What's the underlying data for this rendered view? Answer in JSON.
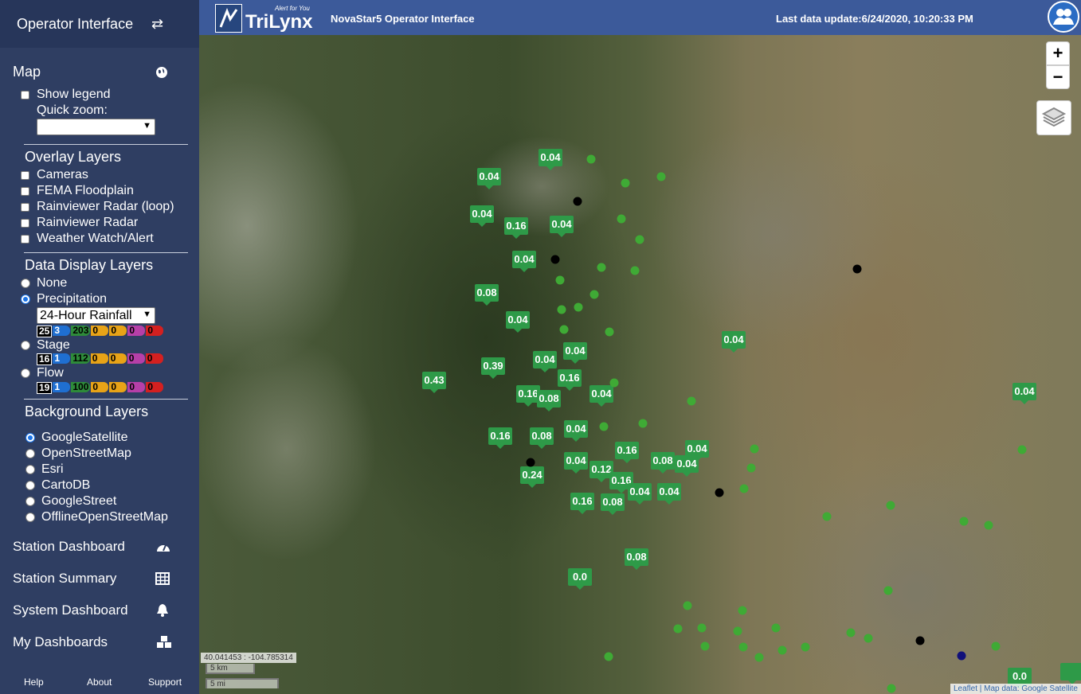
{
  "sidebar": {
    "header": "Operator Interface",
    "header_icon": "swap-icon",
    "map_title": "Map",
    "show_legend": "Show legend",
    "quick_zoom": "Quick zoom:",
    "overlay_title": "Overlay Layers",
    "overlays": [
      "Cameras",
      "FEMA Floodplain",
      "Rainviewer Radar (loop)",
      "Rainviewer Radar",
      "Weather Watch/Alert"
    ],
    "data_title": "Data Display Layers",
    "data_layers": {
      "none": "None",
      "precip": "Precipitation",
      "stage": "Stage",
      "flow": "Flow"
    },
    "precip_select": "24-Hour Rainfall",
    "precip_counts": [
      "25",
      "3",
      "203",
      "0",
      "0",
      "0",
      "0"
    ],
    "stage_counts": [
      "16",
      "1",
      "112",
      "0",
      "0",
      "0",
      "0"
    ],
    "flow_counts": [
      "19",
      "1",
      "100",
      "0",
      "0",
      "0",
      "0"
    ],
    "legend_colors": [
      "#000000",
      "#1f6fd1",
      "#2e8b3a",
      "#e8a317",
      "#e8a317",
      "#b63fa8",
      "#d42020"
    ],
    "bg_title": "Background Layers",
    "bg_layers": [
      "GoogleSatellite",
      "OpenStreetMap",
      "Esri",
      "CartoDB",
      "GoogleStreet",
      "OfflineOpenStreetMap"
    ],
    "nav": [
      {
        "label": "Station Dashboard",
        "icon": "gauge-icon"
      },
      {
        "label": "Station Summary",
        "icon": "table-icon"
      },
      {
        "label": "System Dashboard",
        "icon": "bell-icon"
      },
      {
        "label": "My Dashboards",
        "icon": "cubes-icon"
      }
    ],
    "footer": [
      "Help",
      "About",
      "Support"
    ]
  },
  "topbar": {
    "logo": "TriLynx",
    "logo_tagline": "Alert for You",
    "title": "NovaStar5 Operator Interface",
    "last_update": "Last data update:6/24/2020, 10:20:33 PM"
  },
  "map": {
    "zoom_in": "+",
    "zoom_out": "−",
    "coords": "40.041453 : -104.785314",
    "scale_km": "5 km",
    "scale_mi": "5 mi",
    "attribution_link": "Leaflet",
    "attribution_sep": " | ",
    "attribution_text": "Map data: Google Satellite",
    "pins": [
      "0.04",
      "0.04",
      "0.04",
      "0.16",
      "0.04",
      "0.04",
      "0.08",
      "0.04",
      "0.04",
      "0.04",
      "0.04",
      "0.39",
      "0.43",
      "0.16",
      "0.16",
      "0.08",
      "0.04",
      "0.04",
      "0.16",
      "0.08",
      "0.04",
      "0.16",
      "0.04",
      "0.08",
      "0.04",
      "0.04",
      "0.12",
      "0.16",
      "0.24",
      "0.16",
      "0.08",
      "0.04",
      "0.04",
      "0.08",
      "0.0",
      "0.0"
    ],
    "colors": {
      "pin": "#2e9a48",
      "dot_green": "#3faa35",
      "dot_black": "#000000",
      "dot_navy": "#10107a"
    }
  }
}
